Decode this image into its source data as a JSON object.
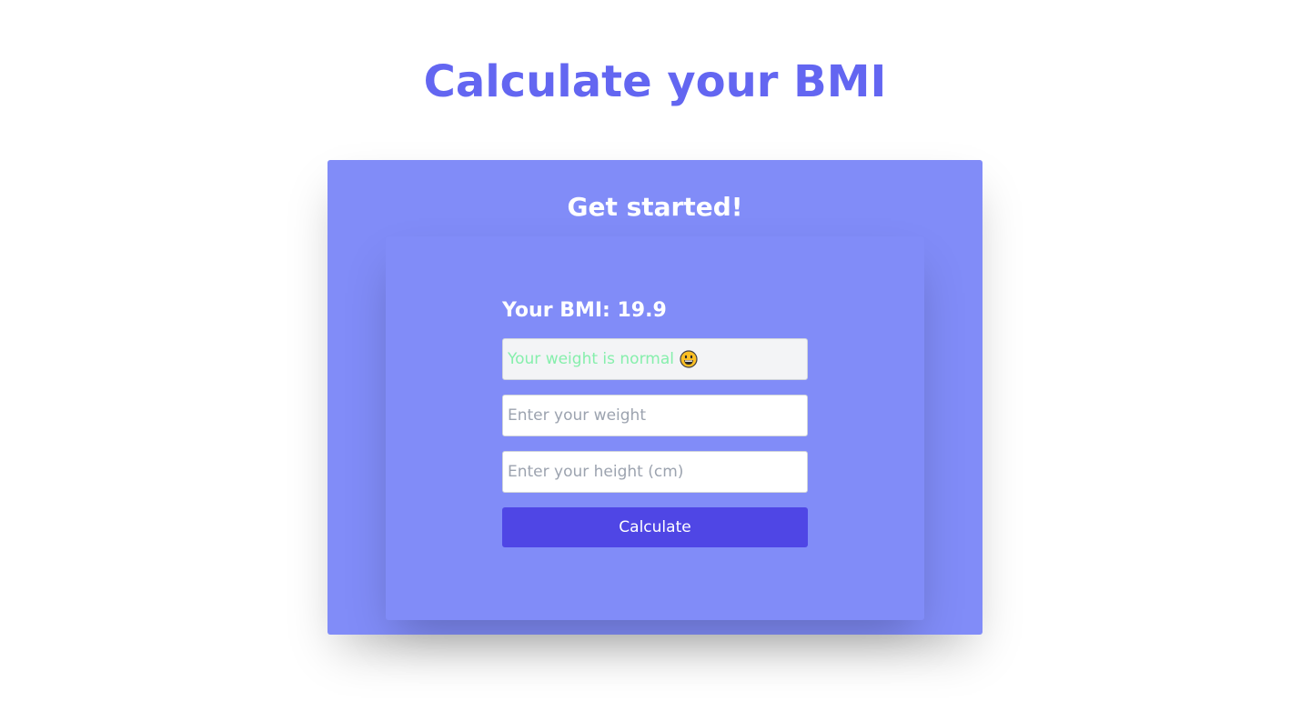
{
  "header": {
    "title": "Calculate your BMI"
  },
  "card": {
    "heading": "Get started!",
    "bmi_result": "Your BMI: 19.9",
    "status_text": "Your weight is normal",
    "status_icon": "grinning-face-emoji",
    "weight_input": {
      "value": "",
      "placeholder": "Enter your weight"
    },
    "height_input": {
      "value": "",
      "placeholder": "Enter your height (cm)"
    },
    "calculate_label": "Calculate"
  },
  "colors": {
    "accent": "#6366f1",
    "card_bg": "#818cf8",
    "button_bg": "#4f46e5",
    "status_text": "#86efac"
  }
}
